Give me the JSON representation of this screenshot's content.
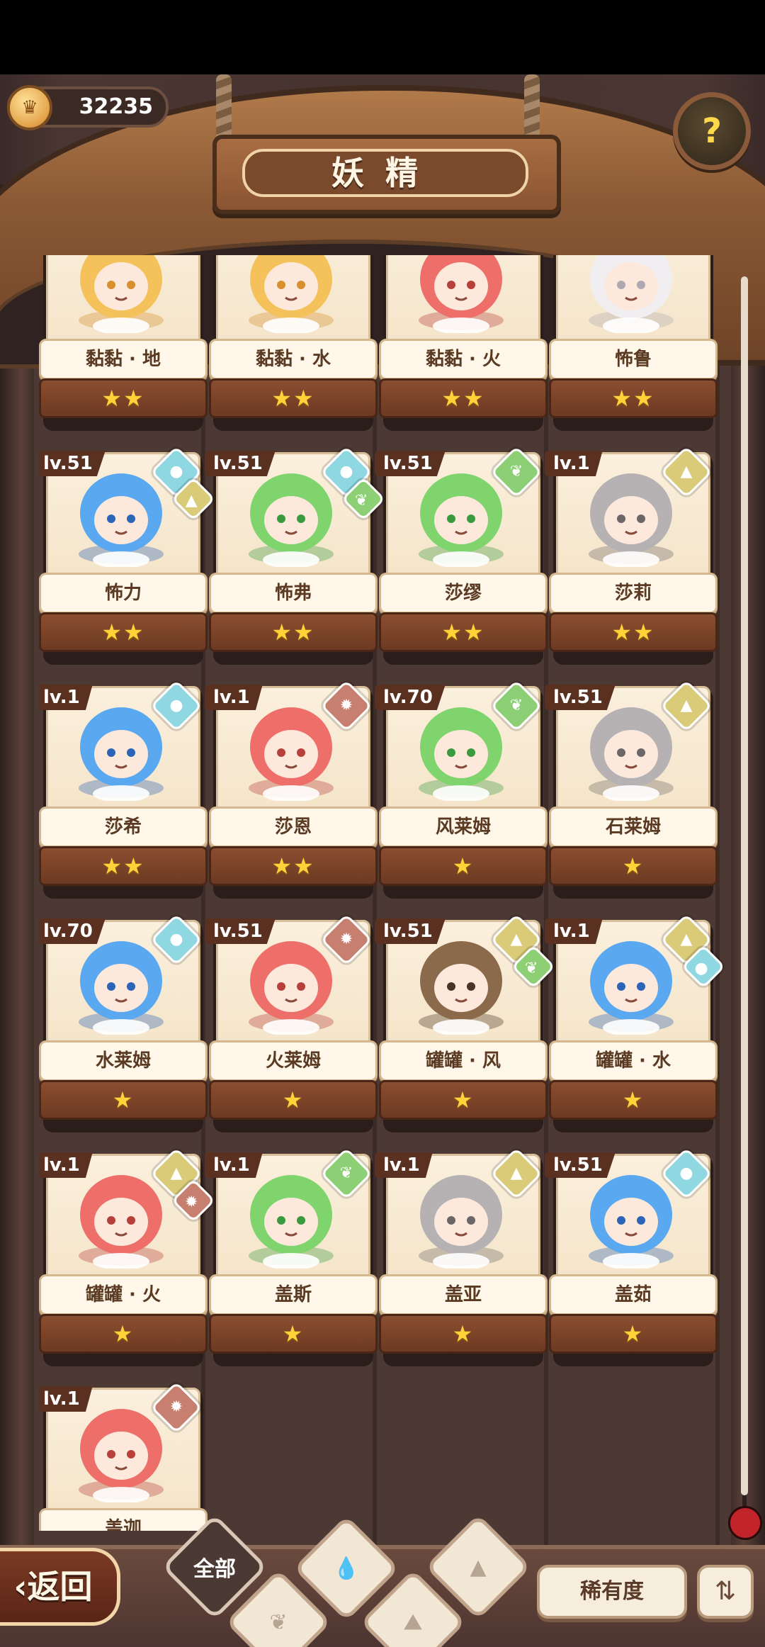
{
  "header": {
    "title": "妖精",
    "coins": "32235",
    "coin_icon": "crown-coin-icon",
    "help_icon": "question-sprout-icon",
    "help_label": "?"
  },
  "colors": {
    "water": "#8fd8e2",
    "earth": "#d9cb78",
    "wind": "#8ccf74",
    "fire": "#c78070",
    "star": "#ffd23a"
  },
  "cards": [
    {
      "name": "黏黏 · 地",
      "level": "",
      "stars": "★★",
      "elements": [],
      "art": "yellow"
    },
    {
      "name": "黏黏 · 水",
      "level": "",
      "stars": "★★",
      "elements": [],
      "art": "yellow"
    },
    {
      "name": "黏黏 · 火",
      "level": "",
      "stars": "★★",
      "elements": [],
      "art": "red"
    },
    {
      "name": "怖鲁",
      "level": "",
      "stars": "★★",
      "elements": [],
      "art": "white"
    },
    {
      "name": "怖力",
      "level": "lv.51",
      "stars": "★★",
      "elements": [
        "water",
        "earth"
      ],
      "art": "blue"
    },
    {
      "name": "怖弗",
      "level": "lv.51",
      "stars": "★★",
      "elements": [
        "water",
        "wind"
      ],
      "art": "green"
    },
    {
      "name": "莎缪",
      "level": "lv.51",
      "stars": "★★",
      "elements": [
        "wind"
      ],
      "art": "green"
    },
    {
      "name": "莎莉",
      "level": "lv.1",
      "stars": "★★",
      "elements": [
        "earth"
      ],
      "art": "gray"
    },
    {
      "name": "莎希",
      "level": "lv.1",
      "stars": "★★",
      "elements": [
        "water"
      ],
      "art": "blue"
    },
    {
      "name": "莎恩",
      "level": "lv.1",
      "stars": "★★",
      "elements": [
        "fire"
      ],
      "art": "red"
    },
    {
      "name": "风莱姆",
      "level": "lv.70",
      "stars": "★",
      "elements": [
        "wind"
      ],
      "art": "green"
    },
    {
      "name": "石莱姆",
      "level": "lv.51",
      "stars": "★",
      "elements": [
        "earth"
      ],
      "art": "gray"
    },
    {
      "name": "水莱姆",
      "level": "lv.70",
      "stars": "★",
      "elements": [
        "water"
      ],
      "art": "blue"
    },
    {
      "name": "火莱姆",
      "level": "lv.51",
      "stars": "★",
      "elements": [
        "fire"
      ],
      "art": "red"
    },
    {
      "name": "罐罐 · 风",
      "level": "lv.51",
      "stars": "★",
      "elements": [
        "earth",
        "wind"
      ],
      "art": "brown"
    },
    {
      "name": "罐罐 · 水",
      "level": "lv.1",
      "stars": "★",
      "elements": [
        "earth",
        "water"
      ],
      "art": "blue"
    },
    {
      "name": "罐罐 · 火",
      "level": "lv.1",
      "stars": "★",
      "elements": [
        "earth",
        "fire"
      ],
      "art": "red"
    },
    {
      "name": "盖斯",
      "level": "lv.1",
      "stars": "★",
      "elements": [
        "wind"
      ],
      "art": "green"
    },
    {
      "name": "盖亚",
      "level": "lv.1",
      "stars": "★",
      "elements": [
        "earth"
      ],
      "art": "gray"
    },
    {
      "name": "盖茹",
      "level": "lv.51",
      "stars": "★",
      "elements": [
        "water"
      ],
      "art": "blue"
    },
    {
      "name": "盖迦",
      "level": "lv.1",
      "stars": "★",
      "elements": [
        "fire"
      ],
      "art": "red"
    }
  ],
  "bottom": {
    "back_label": "返回",
    "tabs": [
      {
        "label": "全部",
        "icon": "all-label",
        "active": true
      },
      {
        "label": "",
        "icon": "sprout-icon",
        "active": false
      },
      {
        "label": "",
        "icon": "water-drop-icon",
        "active": false
      },
      {
        "label": "",
        "icon": "mountain-icon",
        "active": false
      },
      {
        "label": "",
        "icon": "volcano-icon",
        "active": false
      }
    ],
    "rarity_label": "稀有度",
    "sort_icon": "sort-order-icon"
  }
}
